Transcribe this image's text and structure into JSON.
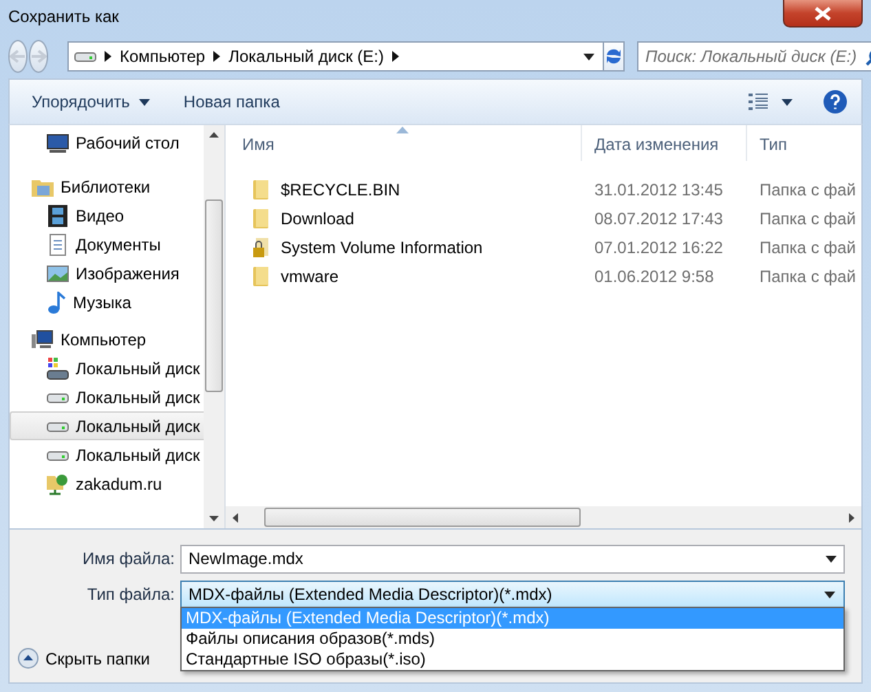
{
  "window": {
    "title": "Сохранить как"
  },
  "address": {
    "crumbs": [
      "Компьютер",
      "Локальный диск (E:)"
    ]
  },
  "search": {
    "placeholder": "Поиск: Локальный диск (E:)"
  },
  "toolbar": {
    "organize": "Упорядочить",
    "new_folder": "Новая папка"
  },
  "sidebar": {
    "loose_items": [
      {
        "label": "Рабочий стол",
        "kind": "desktop",
        "selected": false
      }
    ],
    "groups": [
      {
        "label": "Библиотеки",
        "kind": "library",
        "children": [
          {
            "label": "Видео",
            "kind": "video",
            "selected": false
          },
          {
            "label": "Документы",
            "kind": "documents",
            "selected": false
          },
          {
            "label": "Изображения",
            "kind": "pictures",
            "selected": false
          },
          {
            "label": "Музыка",
            "kind": "music",
            "selected": false
          }
        ]
      },
      {
        "label": "Компьютер",
        "kind": "computer",
        "children": [
          {
            "label": "Локальный диск",
            "kind": "system-drive",
            "selected": false
          },
          {
            "label": "Локальный диск",
            "kind": "drive",
            "selected": false
          },
          {
            "label": "Локальный диск",
            "kind": "drive",
            "selected": true
          },
          {
            "label": "Локальный диск",
            "kind": "drive",
            "selected": false
          },
          {
            "label": "zakadum.ru",
            "kind": "network",
            "selected": false
          }
        ]
      }
    ]
  },
  "file_list": {
    "columns": [
      "Имя",
      "Дата изменения",
      "Тип"
    ],
    "rows": [
      {
        "name": "$RECYCLE.BIN",
        "date": "31.01.2012 13:45",
        "type": "Папка с фай",
        "kind": "folder"
      },
      {
        "name": "Download",
        "date": "08.07.2012 17:43",
        "type": "Папка с фай",
        "kind": "folder"
      },
      {
        "name": "System Volume Information",
        "date": "07.01.2012 16:22",
        "type": "Папка с фай",
        "kind": "locked-folder"
      },
      {
        "name": "vmware",
        "date": "01.06.2012 9:58",
        "type": "Папка с фай",
        "kind": "folder"
      }
    ]
  },
  "file_name": {
    "label": "Имя файла:",
    "value": "NewImage.mdx"
  },
  "file_type": {
    "label": "Тип файла:",
    "value": "MDX-файлы (Extended Media Descriptor)(*.mdx)",
    "options": [
      {
        "label": "MDX-файлы (Extended Media Descriptor)(*.mdx)",
        "selected": true
      },
      {
        "label": "Файлы описания образов(*.mds)",
        "selected": false
      },
      {
        "label": "Стандартные ISO образы(*.iso)",
        "selected": false
      }
    ]
  },
  "hide_folders": "Скрыть папки"
}
